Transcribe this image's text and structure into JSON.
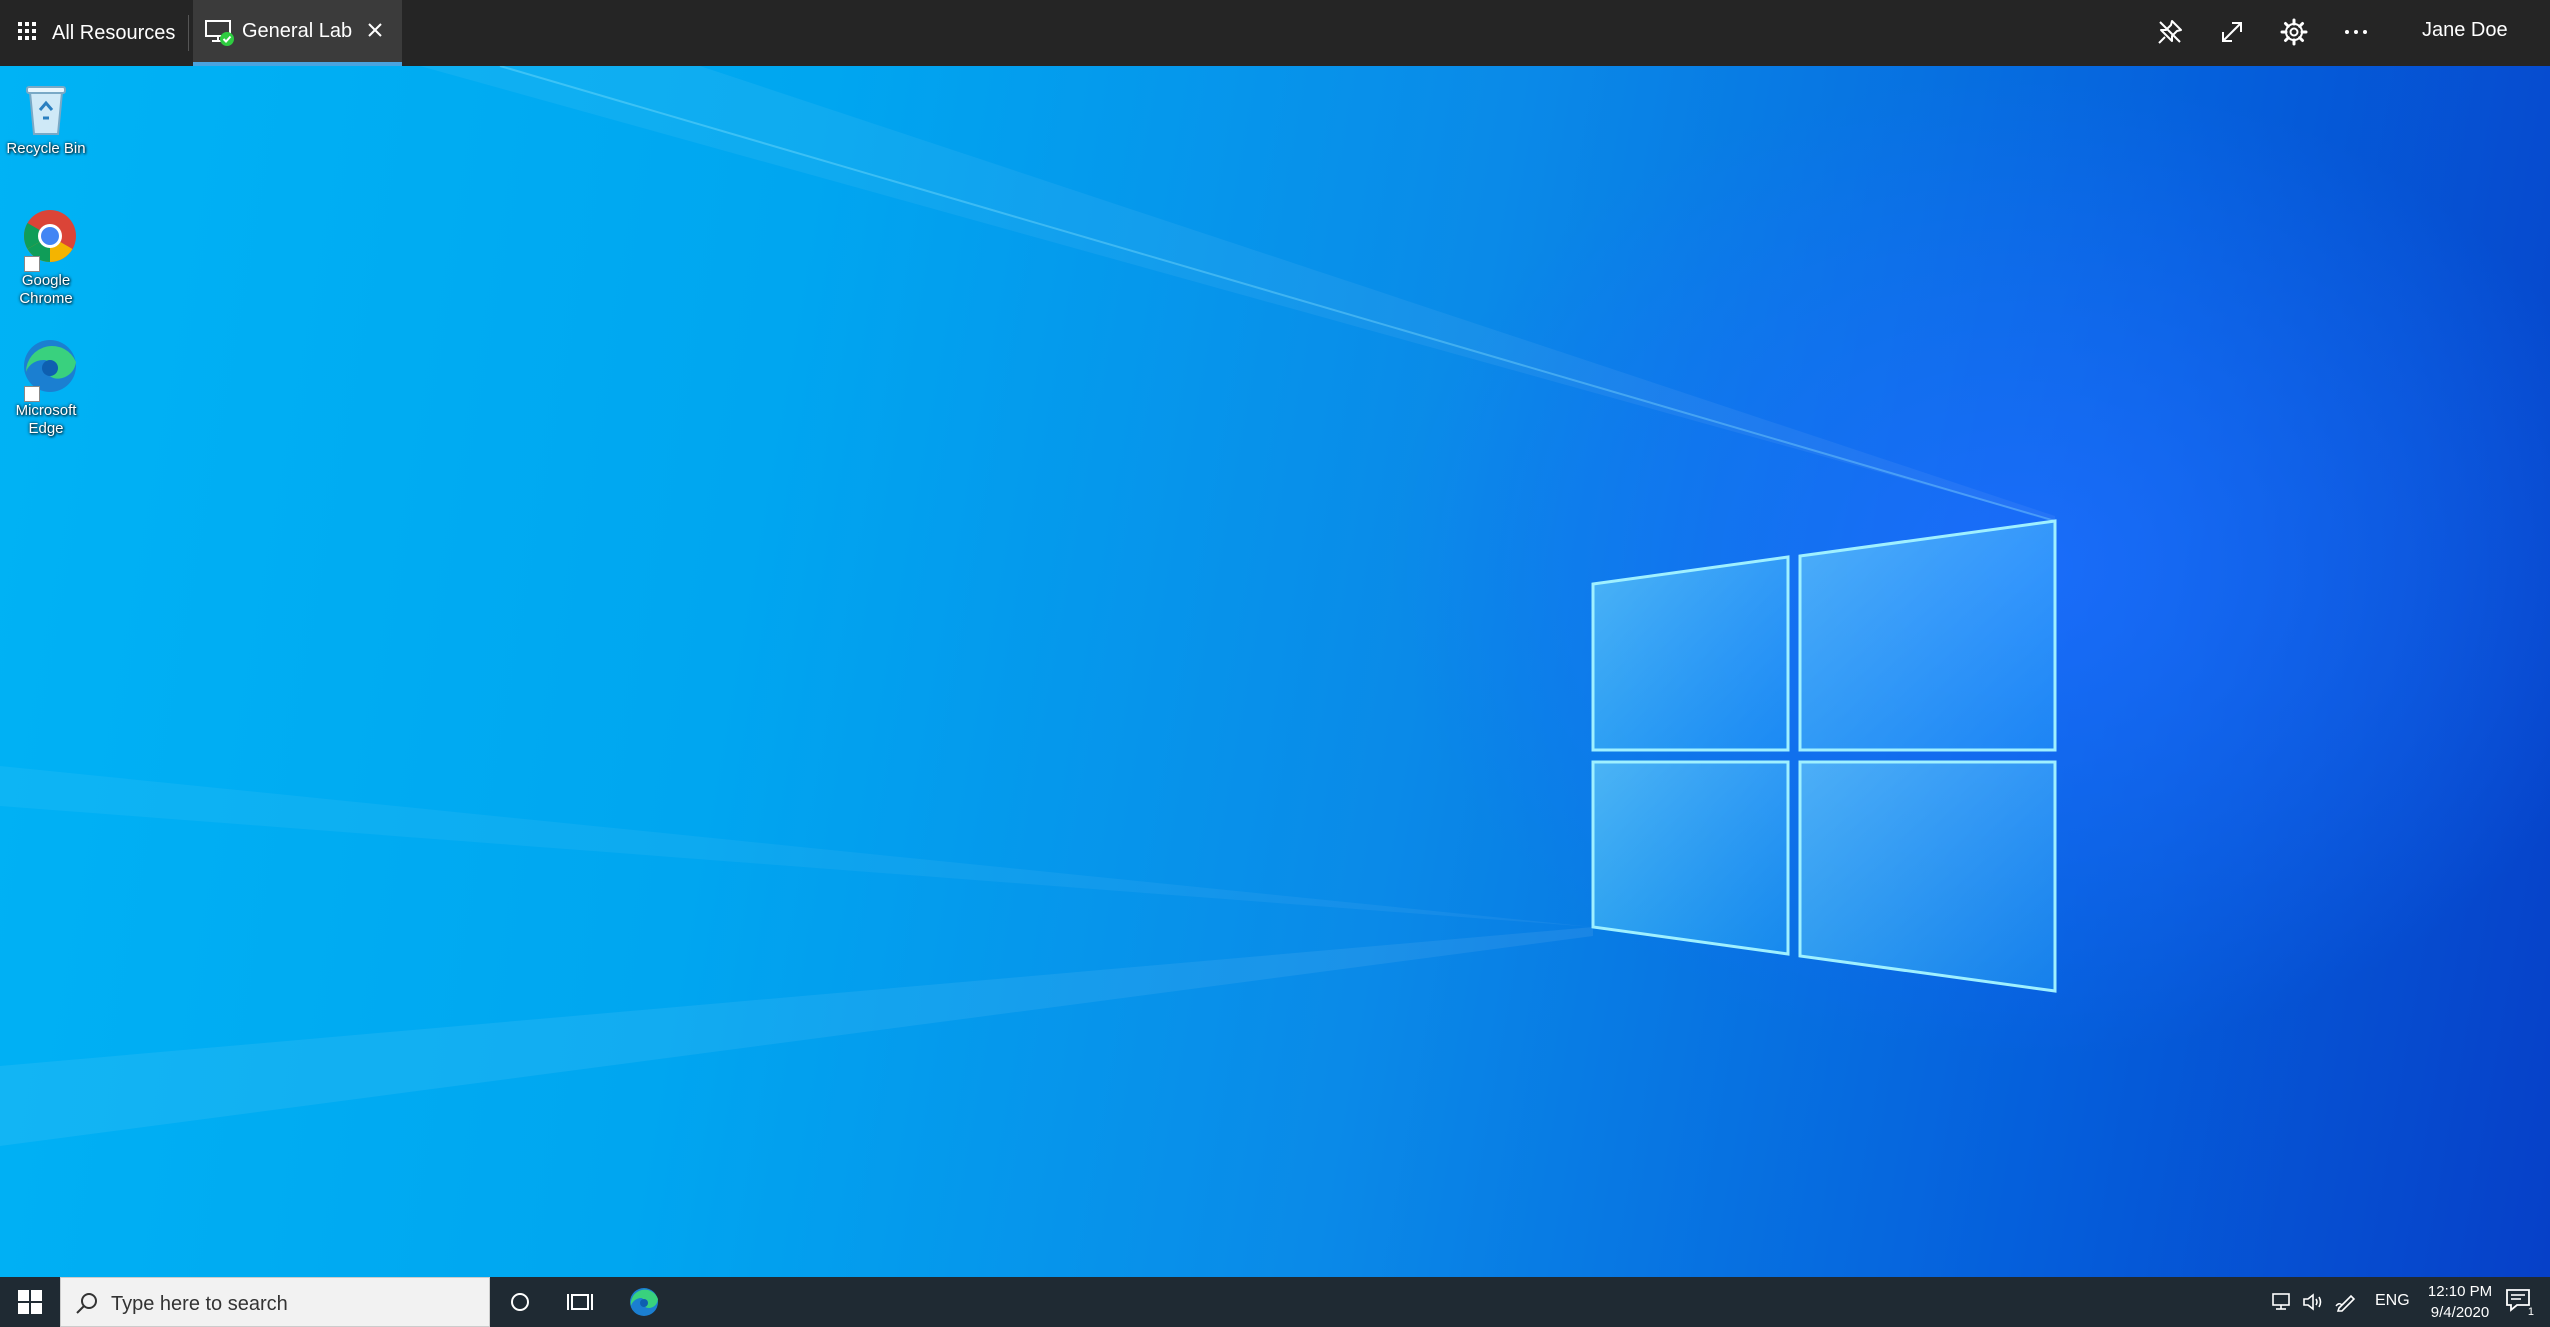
{
  "topbar": {
    "all_resources_label": "All Resources",
    "tab": {
      "label": "General Lab"
    },
    "user_name": "Jane Doe",
    "icons": [
      "apps-grid-icon",
      "monitor-connected-icon",
      "close-icon",
      "pin-icon",
      "expand-icon",
      "gear-icon",
      "more-icon"
    ]
  },
  "desktop": {
    "icons": [
      {
        "label": "Recycle Bin"
      },
      {
        "label": "Google Chrome"
      },
      {
        "label": "Microsoft Edge"
      }
    ]
  },
  "taskbar": {
    "search_placeholder": "Type here to search",
    "language": "ENG",
    "time": "12:10 PM",
    "date": "9/4/2020",
    "notification_count": "1"
  },
  "colors": {
    "topbar_bg": "#252525",
    "tab_accent": "#4aa3df",
    "taskbar_bg": "#1f2a33",
    "status_green": "#2ecc40"
  }
}
